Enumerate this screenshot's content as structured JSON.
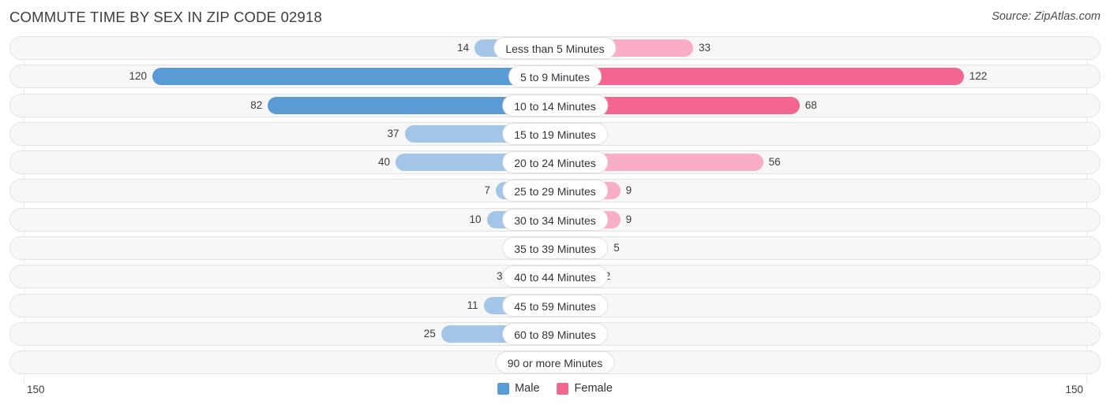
{
  "header": {
    "title": "COMMUTE TIME BY SEX IN ZIP CODE 02918",
    "source": "Source: ZipAtlas.com"
  },
  "footer": {
    "axis_start": "150",
    "axis_end": "150",
    "legend": [
      {
        "label": "Male",
        "color": "#5b9bd5"
      },
      {
        "label": "Female",
        "color": "#f2668f"
      }
    ]
  },
  "colors": {
    "male_strong": "#5b9bd5",
    "male_light": "#a3c6e8",
    "female_strong": "#f2668f",
    "female_light": "#f9aec5",
    "track": "#f7f7f7",
    "track_border": "#e3e3e3",
    "gridline": "#e8e8e8",
    "text": "#3b3b42"
  },
  "chart_data": {
    "type": "bar",
    "subtype": "diverging-bidirectional",
    "title": "COMMUTE TIME BY SEX IN ZIP CODE 02918",
    "xlabel": "",
    "ylabel": "",
    "xlim": [
      150,
      150
    ],
    "axis_max": 150,
    "grid": true,
    "legend_position": "bottom-center",
    "categories": [
      "Less than 5 Minutes",
      "5 to 9 Minutes",
      "10 to 14 Minutes",
      "15 to 19 Minutes",
      "20 to 24 Minutes",
      "25 to 29 Minutes",
      "30 to 34 Minutes",
      "35 to 39 Minutes",
      "40 to 44 Minutes",
      "45 to 59 Minutes",
      "60 to 89 Minutes",
      "90 or more Minutes"
    ],
    "series": [
      {
        "name": "Male",
        "direction": "left",
        "color": "#5b9bd5",
        "values": [
          14,
          120,
          82,
          37,
          40,
          7,
          10,
          0,
          3,
          11,
          25,
          0
        ]
      },
      {
        "name": "Female",
        "direction": "right",
        "color": "#f2668f",
        "values": [
          33,
          122,
          68,
          0,
          56,
          9,
          9,
          5,
          2,
          0,
          0,
          0
        ]
      }
    ]
  }
}
